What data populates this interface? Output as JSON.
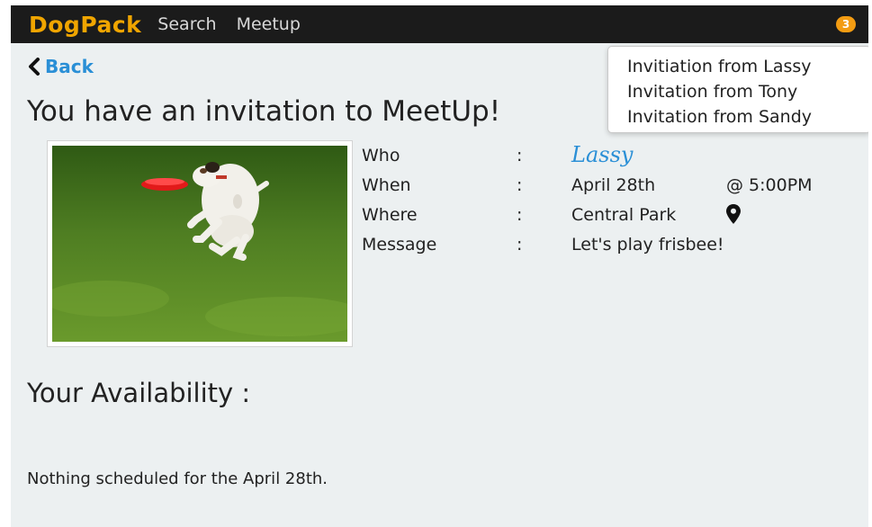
{
  "navbar": {
    "brand": "DogPack",
    "links": [
      "Search",
      "Meetup"
    ],
    "notification_count": "3"
  },
  "notifications": [
    "Invitiation from Lassy",
    "Invitation from Tony",
    "Invitation from Sandy"
  ],
  "back_label": "Back",
  "page_title": "You have an invitation to MeetUp!",
  "invitation": {
    "who_label": "Who",
    "who": "Lassy",
    "when_label": "When",
    "date": "April 28th",
    "time": "@ 5:00PM",
    "where_label": "Where",
    "place": "Central Park",
    "message_label": "Message",
    "message": "Let's play frisbee!",
    "separator": ":"
  },
  "availability": {
    "heading": "Your Availability :",
    "status": "Nothing scheduled for the April 28th."
  },
  "icons": {
    "back": "chevron-left-icon",
    "location": "map-pin-icon"
  },
  "colors": {
    "brand": "#f0a500",
    "link": "#2a8fd6",
    "badge": "#f39c12",
    "navbar": "#1b1b1b",
    "background": "#ecf0f1"
  }
}
